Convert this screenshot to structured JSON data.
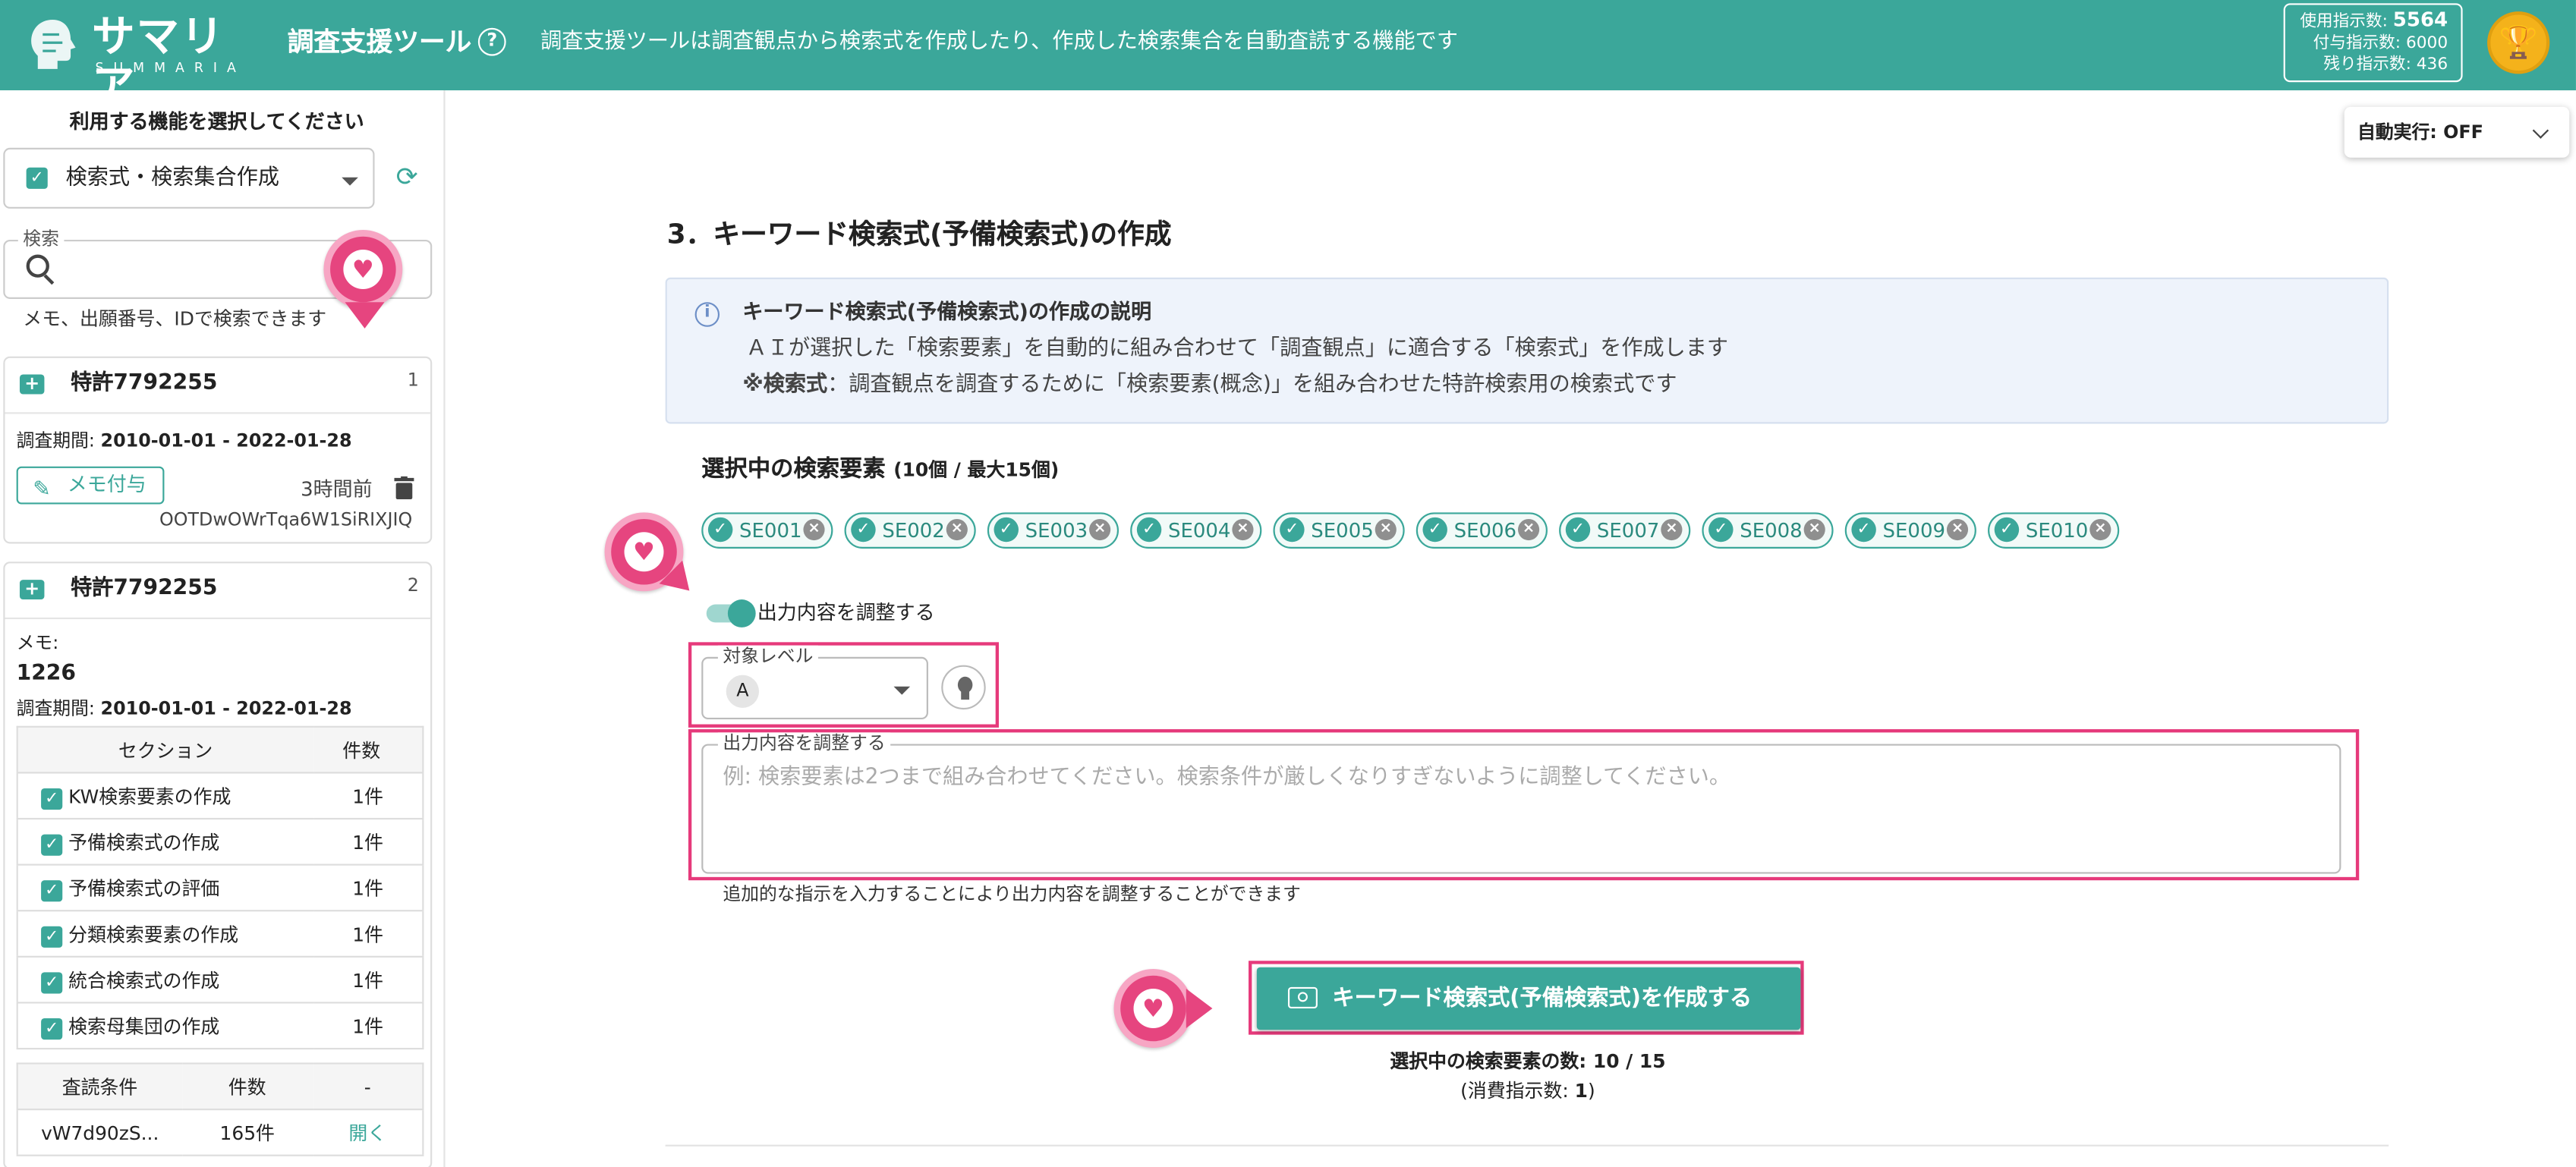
{
  "header": {
    "brand_jp": "サマリア",
    "brand_en": "SUMMARIA",
    "app_title": "調査支援ツール",
    "help_icon": "?",
    "description": "調査支援ツールは調査観点から検索式を作成したり、作成した検索集合を自動査読する機能です",
    "usage": {
      "used_label": "使用指示数:",
      "used_value": "5564",
      "granted_label": "付与指示数:",
      "granted_value": "6000",
      "remaining_label": "残り指示数:",
      "remaining_value": "436"
    },
    "trophy_icon": "trophy-icon"
  },
  "sidebar": {
    "heading": "利用する機能を選択してください",
    "function_select": "検索式・検索集合作成",
    "search_legend": "検索",
    "search_value": "",
    "search_hint": "メモ、出願番号、IDで検索できます",
    "cards": [
      {
        "title": "特許7792255",
        "index": "1",
        "period_label": "調査期間:",
        "period": "2010-01-01 - 2022-01-28",
        "memo_button": "メモ付与",
        "time": "3時間前",
        "id": "OOTDwOWrTqa6W1SiRIXJIQ"
      },
      {
        "title": "特許7792255",
        "index": "2",
        "memo_label": "メモ:",
        "memo": "1226",
        "period_label": "調査期間:",
        "period": "2010-01-01 - 2022-01-28",
        "table_headers": [
          "セクション",
          "件数"
        ],
        "rows": [
          {
            "section": "KW検索要素の作成",
            "count": "1件"
          },
          {
            "section": "予備検索式の作成",
            "count": "1件"
          },
          {
            "section": "予備検索式の評価",
            "count": "1件"
          },
          {
            "section": "分類検索要素の作成",
            "count": "1件"
          },
          {
            "section": "統合検索式の作成",
            "count": "1件"
          },
          {
            "section": "検索母集団の作成",
            "count": "1件"
          }
        ],
        "review_headers": [
          "査読条件",
          "件数",
          "-"
        ],
        "review_row": {
          "condition": "vW7d90zS...",
          "count": "165件",
          "action": "開く"
        }
      }
    ]
  },
  "main": {
    "auto_run": "自動実行: OFF",
    "section_title": "3．キーワード検索式(予備検索式)の作成",
    "info": {
      "heading": "キーワード検索式(予備検索式)の作成の説明",
      "line1": "ＡＩが選択した「検索要素」を自動的に組み合わせて「調査観点」に適合する「検索式」を作成します",
      "line2_bold": "※検索式",
      "line2": "：調査観点を調査するために「検索要素(概念)」を組み合わせた特許検索用の検索式です"
    },
    "selected_title": "選択中の検索要素",
    "selected_sub": "(10個 / 最大15個)",
    "chips": [
      "SE001",
      "SE002",
      "SE003",
      "SE004",
      "SE005",
      "SE006",
      "SE007",
      "SE008",
      "SE009",
      "SE010"
    ],
    "toggle_label": "出力内容を調整する",
    "level_legend": "対象レベル",
    "level_value": "A",
    "output_legend": "出力内容を調整する",
    "output_placeholder": "例: 検索要素は2つまで組み合わせてください。検索条件が厳しくなりすぎないように調整してください。",
    "output_value": "",
    "output_hint": "追加的な指示を入力することにより出力内容を調整することができます",
    "create_button": "キーワード検索式(予備検索式)を作成する",
    "count_line": "選択中の検索要素の数: 10 / 15",
    "consume_prefix": "(消費指示数: ",
    "consume_value": "1",
    "consume_suffix": ")"
  },
  "colors": {
    "brand": "#3ba79a",
    "highlight": "#e63a7b",
    "heart": "#e6457f"
  }
}
